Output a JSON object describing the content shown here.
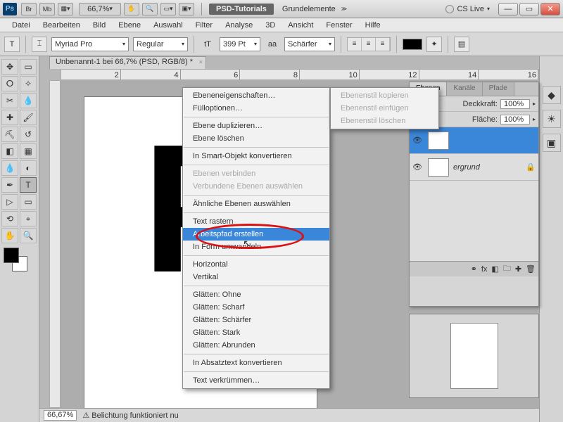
{
  "title": {
    "zoom": "66,7%",
    "workspace1": "PSD-Tutorials",
    "workspace2": "Grundelemente",
    "cslive": "CS Live"
  },
  "menu": {
    "datei": "Datei",
    "bearbeiten": "Bearbeiten",
    "bild": "Bild",
    "ebene": "Ebene",
    "auswahl": "Auswahl",
    "filter": "Filter",
    "analyse": "Analyse",
    "dd": "3D",
    "ansicht": "Ansicht",
    "fenster": "Fenster",
    "hilfe": "Hilfe"
  },
  "opt": {
    "font": "Myriad Pro",
    "weight": "Regular",
    "size": "399 Pt",
    "aa": "Schärfer"
  },
  "doc": {
    "tab": "Unbenannt-1 bei 66,7% (PSD, RGB/8) *",
    "glyph": "P"
  },
  "ruler": {
    "m2": "2",
    "m4": "4",
    "m6": "6",
    "m8": "8",
    "m10": "10",
    "m12": "12",
    "m14": "14",
    "m16": "16"
  },
  "status": {
    "zoom": "66,67%",
    "msg": "Belichtung funktioniert nu"
  },
  "layers": {
    "tab1": "Ebenen",
    "tab2": "Kanäle",
    "tab3": "Pfade",
    "opacity_label": "Deckkraft:",
    "opacity_val": "100%",
    "fill_label": "Fläche:",
    "fill_val": "100%",
    "bg_name": "ergrund"
  },
  "ctx1": {
    "props": "Ebeneneigenschaften…",
    "blend": "Fülloptionen…",
    "dup": "Ebene duplizieren…",
    "del": "Ebene löschen",
    "smart": "In Smart-Objekt konvertieren",
    "merge": "Ebenen verbinden",
    "mergevis": "Verbundene Ebenen auswählen",
    "similar": "Ähnliche Ebenen auswählen",
    "raster": "Text rastern",
    "workpath": "Arbeitspfad erstellen",
    "toshape": "In Form umwandeln",
    "horiz": "Horizontal",
    "vert": "Vertikal",
    "aa_none": "Glätten: Ohne",
    "aa_sharp": "Glätten: Scharf",
    "aa_crisp": "Glätten: Schärfer",
    "aa_strong": "Glätten: Stark",
    "aa_smooth": "Glätten: Abrunden",
    "para": "In Absatztext konvertieren",
    "warp": "Text verkrümmen…"
  },
  "ctx2": {
    "copy": "Ebenenstil kopieren",
    "paste": "Ebenenstil einfügen",
    "clear": "Ebenenstil löschen"
  }
}
